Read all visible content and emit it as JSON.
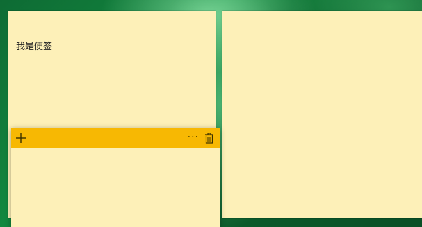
{
  "notes": [
    {
      "text": "我是便签"
    },
    {
      "text": ""
    }
  ],
  "active_note": {
    "text": "",
    "toolbar": {
      "new_icon": "plus-icon",
      "menu_icon": "more-options-icon",
      "delete_icon": "trash-icon",
      "menu_glyph": "···"
    }
  },
  "colors": {
    "note_background": "#fdf0b8",
    "toolbar_background": "#f7b803",
    "desktop_green": "#13883f"
  }
}
